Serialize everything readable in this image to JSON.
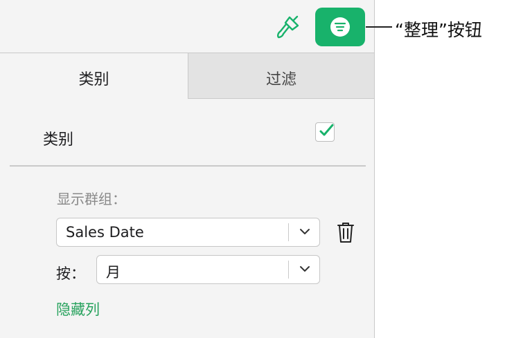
{
  "tabs": [
    {
      "label": "类别",
      "active": true
    },
    {
      "label": "过滤",
      "active": false
    }
  ],
  "category": {
    "label": "类别",
    "checked": true
  },
  "group": {
    "title": "显示群组：",
    "group_by_value": "Sales Date",
    "by_label": "按：",
    "interval_value": "月",
    "hide_column_link": "隐藏列"
  },
  "callout": {
    "text": "“整理”按钮"
  },
  "icons": {
    "format": "paintbrush-icon",
    "organize": "organize-icon",
    "delete": "trash-icon",
    "dropdown": "chevron-down-icon",
    "check": "checkmark-icon"
  },
  "colors": {
    "accent": "#18b26b",
    "link": "#27a25d"
  }
}
